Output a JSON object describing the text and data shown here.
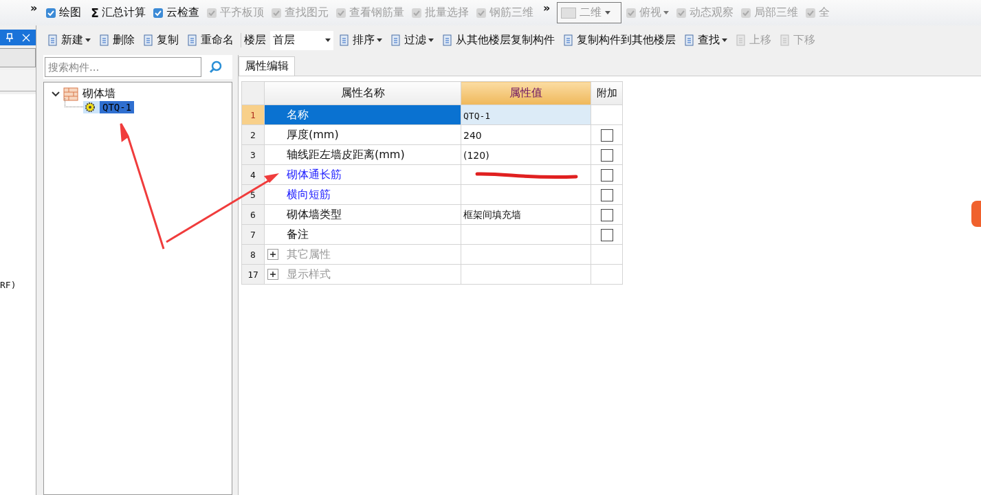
{
  "main_toolbar": [
    {
      "label": "»",
      "kind": "overflow",
      "disabled": false
    },
    {
      "label": "绘图",
      "kind": "tool",
      "disabled": false
    },
    {
      "label": "Σ",
      "kind": "glyph",
      "disabled": false
    },
    {
      "label": "汇总计算",
      "kind": "text",
      "disabled": false
    },
    {
      "label": "云检查",
      "kind": "tool",
      "disabled": false
    },
    {
      "label": "平齐板顶",
      "kind": "tool",
      "disabled": true
    },
    {
      "label": "查找图元",
      "kind": "tool",
      "disabled": true
    },
    {
      "label": "查看钢筋量",
      "kind": "tool",
      "disabled": true
    },
    {
      "label": "批量选择",
      "kind": "tool",
      "disabled": true
    },
    {
      "label": "钢筋三维",
      "kind": "tool",
      "disabled": true
    },
    {
      "label": "»",
      "kind": "overflow",
      "disabled": false
    },
    {
      "label": "二维",
      "kind": "combo",
      "disabled": true
    },
    {
      "label": "俯视",
      "kind": "menu",
      "disabled": true
    },
    {
      "label": "动态观察",
      "kind": "tool",
      "disabled": true
    },
    {
      "label": "局部三维",
      "kind": "tool",
      "disabled": true
    },
    {
      "label": "全",
      "kind": "tool",
      "disabled": true
    }
  ],
  "side_strip": {
    "text": "RF)"
  },
  "component_toolbar": [
    {
      "label": "新建",
      "kind": "menu",
      "disabled": false
    },
    {
      "label": "删除",
      "kind": "tool",
      "disabled": false
    },
    {
      "label": "复制",
      "kind": "tool",
      "disabled": false
    },
    {
      "label": "重命名",
      "kind": "tool",
      "disabled": false
    },
    {
      "label": "楼层",
      "kind": "label",
      "disabled": false
    },
    {
      "label": "首层",
      "kind": "combo",
      "disabled": false
    },
    {
      "label": "排序",
      "kind": "menu",
      "disabled": false
    },
    {
      "label": "过滤",
      "kind": "menu",
      "disabled": false
    },
    {
      "label": "从其他楼层复制构件",
      "kind": "tool",
      "disabled": false
    },
    {
      "label": "复制构件到其他楼层",
      "kind": "tool",
      "disabled": false
    },
    {
      "label": "查找",
      "kind": "menu",
      "disabled": false
    },
    {
      "label": "上移",
      "kind": "tool",
      "disabled": true
    },
    {
      "label": "下移",
      "kind": "tool",
      "disabled": true
    }
  ],
  "search": {
    "placeholder": "搜索构件..."
  },
  "tree": [
    {
      "label": "砌体墙",
      "expanded": true,
      "selected": false,
      "children": [
        {
          "label": "QTQ-1",
          "selected": true
        }
      ]
    }
  ],
  "tabs": [
    {
      "label": "属性编辑",
      "selected": true
    }
  ],
  "table": {
    "columns": [
      "属性名称",
      "属性值",
      "附加"
    ],
    "rows": [
      {
        "number": "1",
        "name": "名称",
        "value": "QTQ-1",
        "kind": "plain",
        "selected": true
      },
      {
        "number": "2",
        "name": "厚度(mm)",
        "value": "240",
        "kind": "plain",
        "selected": false,
        "checked": false
      },
      {
        "number": "3",
        "name": "轴线距左墙皮距离(mm)",
        "value": "(120)",
        "kind": "plain",
        "selected": false,
        "checked": false
      },
      {
        "number": "4",
        "name": "砌体通长筋",
        "value": "",
        "kind": "link",
        "selected": false,
        "checked": false
      },
      {
        "number": "5",
        "name": "横向短筋",
        "value": "",
        "kind": "link",
        "selected": false,
        "checked": false
      },
      {
        "number": "6",
        "name": "砌体墙类型",
        "value": "框架间填充墙",
        "kind": "plain",
        "selected": false,
        "checked": false
      },
      {
        "number": "7",
        "name": "备注",
        "value": "",
        "kind": "plain",
        "selected": false,
        "checked": false
      },
      {
        "number": "8",
        "name": "其它属性",
        "value": "",
        "kind": "group",
        "selected": false,
        "expanded": false
      },
      {
        "number": "17",
        "name": "显示样式",
        "value": "",
        "kind": "group",
        "selected": false,
        "expanded": false
      }
    ]
  }
}
